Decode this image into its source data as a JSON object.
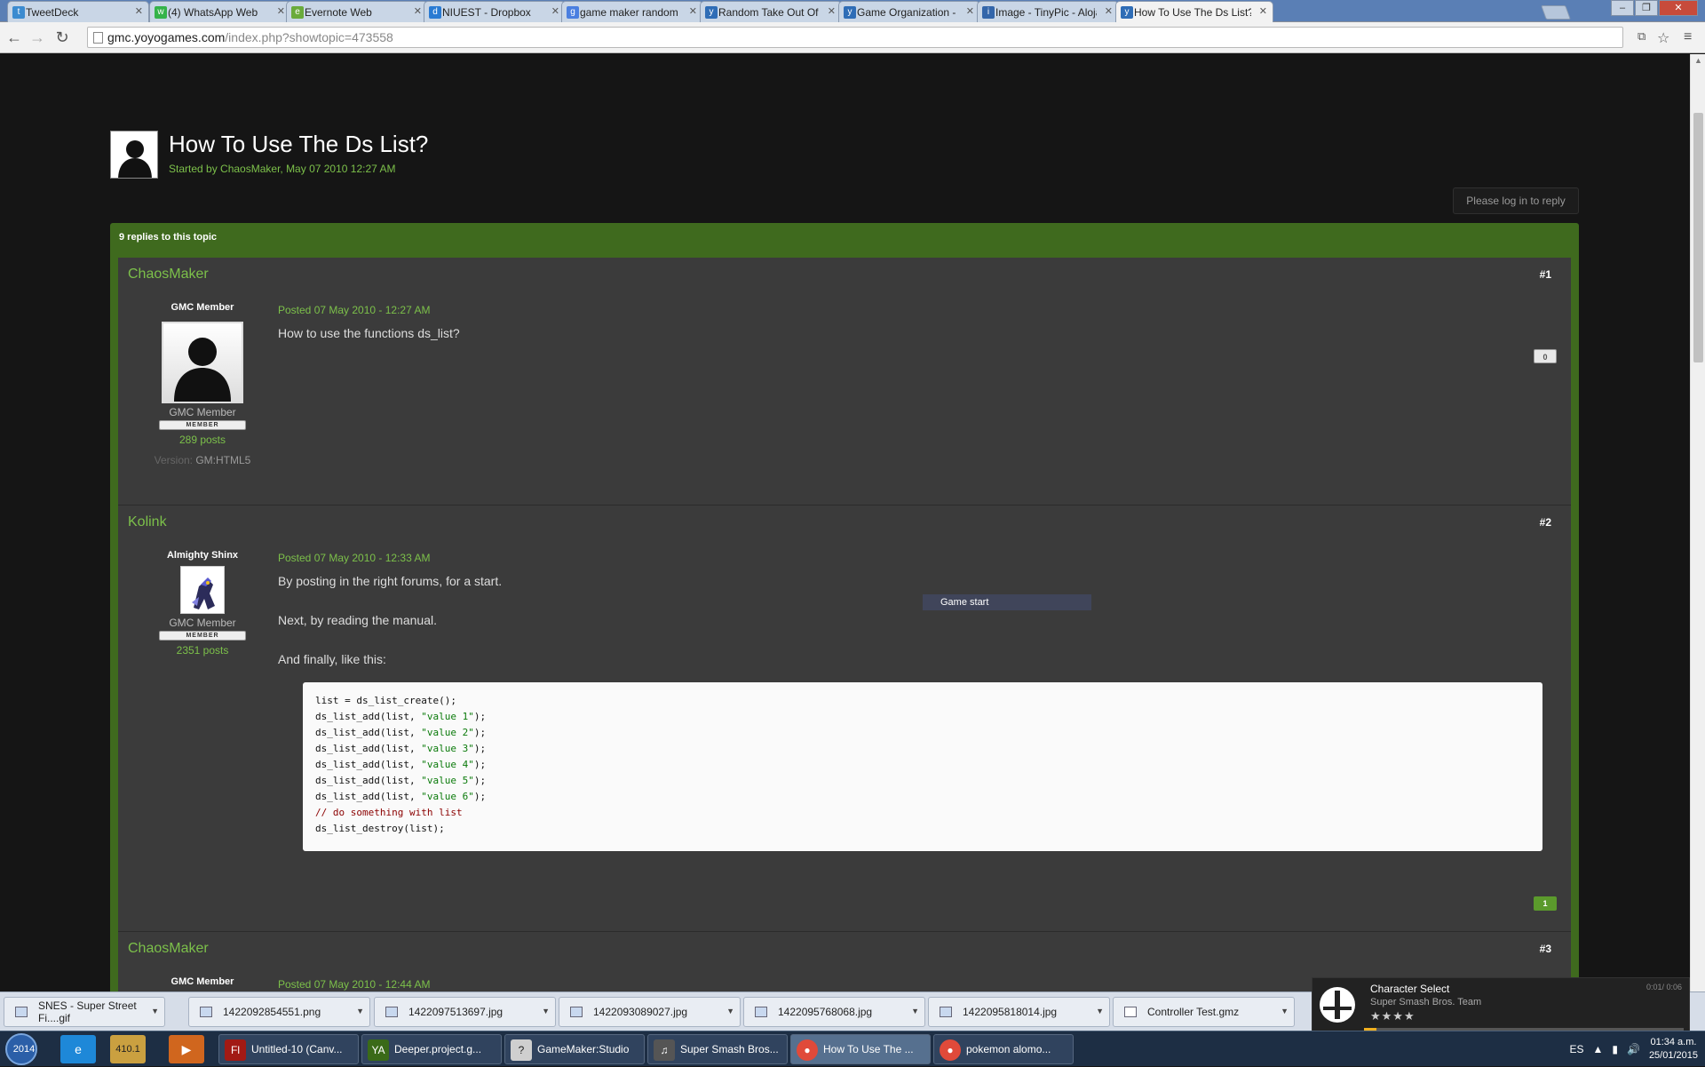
{
  "browser": {
    "tabs": [
      {
        "label": "TweetDeck",
        "icon": "twitter-icon",
        "color": "#3b8bd0"
      },
      {
        "label": "(4) WhatsApp Web",
        "icon": "whatsapp-icon",
        "color": "#35b34a"
      },
      {
        "label": "Evernote Web",
        "icon": "evernote-icon",
        "color": "#6aab3b"
      },
      {
        "label": "NIUEST - Dropbox",
        "icon": "dropbox-icon",
        "color": "#2a7bd3"
      },
      {
        "label": "game maker random list -",
        "icon": "google-icon",
        "color": "#4a7fe0"
      },
      {
        "label": "Random Take Out Of List",
        "icon": "gamemaker-icon",
        "color": "#2f6db6"
      },
      {
        "label": "Game Organization - Con",
        "icon": "gamemaker-icon",
        "color": "#2f6db6"
      },
      {
        "label": "Image - TinyPic - Alojami",
        "icon": "tinypic-icon",
        "color": "#3366aa"
      },
      {
        "label": "How To Use The Ds List? -",
        "icon": "gamemaker-icon",
        "color": "#2f6db6"
      }
    ],
    "url_domain": "gmc.yoyogames.com",
    "url_path": "/index.php?showtopic=473558"
  },
  "topic": {
    "title": "How To Use The Ds List?",
    "started_by": "Started by ChaosMaker, May 07 2010 12:27 AM",
    "reply_button": "Please log in to reply",
    "replies_header": "9 replies to this topic"
  },
  "posts": [
    {
      "author": "ChaosMaker",
      "number": "#1",
      "user_title": "GMC Member",
      "group": "GMC Member",
      "badge": "MEMBER",
      "post_count": "289 posts",
      "version_label": "Version:",
      "version": "GM:HTML5",
      "date": "Posted 07 May 2010 - 12:27 AM",
      "body": "How to use the functions ds_list?",
      "reputation": "0"
    },
    {
      "author": "Kolink",
      "number": "#2",
      "user_title": "Almighty Shinx",
      "group": "GMC Member",
      "badge": "MEMBER",
      "post_count": "2351 posts",
      "date": "Posted 07 May 2010 - 12:33 AM",
      "body_lines": [
        "By posting in the right forums, for a start.",
        "Next, by reading the manual.",
        "And finally, like this:"
      ],
      "code": [
        {
          "t": "list = ds_list_create();",
          "k": "plain"
        },
        {
          "t": "ds_list_add(list, \"value 1\");",
          "k": "plain"
        },
        {
          "t": "ds_list_add(list, \"value 2\");",
          "k": "plain"
        },
        {
          "t": "ds_list_add(list, \"value 3\");",
          "k": "plain"
        },
        {
          "t": "ds_list_add(list, \"value 4\");",
          "k": "plain"
        },
        {
          "t": "ds_list_add(list, \"value 5\");",
          "k": "plain"
        },
        {
          "t": "ds_list_add(list, \"value 6\");",
          "k": "plain"
        },
        {
          "t": "// do something with list",
          "k": "comment"
        },
        {
          "t": "ds_list_destroy(list);",
          "k": "plain"
        }
      ],
      "reputation": "1"
    },
    {
      "author": "ChaosMaker",
      "number": "#3",
      "user_title": "GMC Member",
      "date": "Posted 07 May 2010 - 12:44 AM"
    }
  ],
  "overlay_tooltip": "Game start",
  "downloads": [
    "SNES - Super Street Fi....gif",
    "1422092854551.png",
    "1422097513697.jpg",
    "1422093089027.jpg",
    "1422095768068.jpg",
    "1422095818014.jpg",
    "Controller Test.gmz"
  ],
  "media": {
    "title": "Character Select",
    "artist": "Super Smash Bros. Team",
    "rating_stars": "★★★★",
    "rating_value": 4,
    "time": "0:01/ 0:06",
    "progress": 0.04
  },
  "taskbar": {
    "pinned_labels": [
      "2014",
      "410.1"
    ],
    "tasks": [
      {
        "label": "Untitled-10 (Canv...",
        "icon": "flash-icon"
      },
      {
        "label": "Deeper.project.g...",
        "icon": "gamemaker-icon"
      },
      {
        "label": "GameMaker:Studio",
        "icon": "gamemaker-studio-icon"
      },
      {
        "label": "Super Smash Bros...",
        "icon": "media-player-icon"
      },
      {
        "label": "How To Use The ...",
        "icon": "chrome-icon"
      },
      {
        "label": "pokemon alomo...",
        "icon": "chrome-icon"
      }
    ],
    "lang": "ES",
    "time": "01:34 a.m.",
    "date": "25/01/2015"
  }
}
